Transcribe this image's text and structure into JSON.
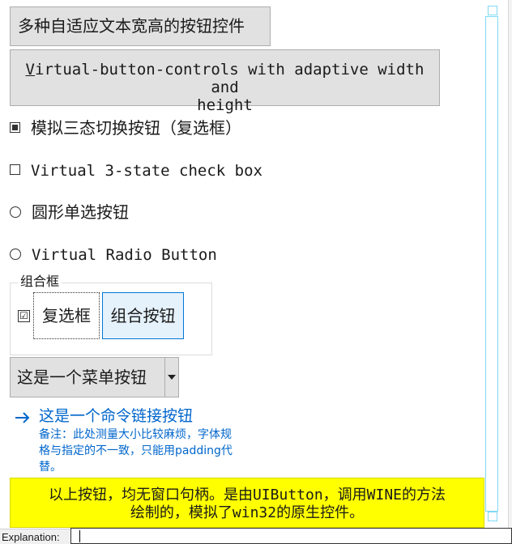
{
  "buttons": {
    "adaptive_cn": "多种自适应文本宽高的按钮控件",
    "adaptive_en_line1_first": "V",
    "adaptive_en_line1_rest": "irtual-button-controls with adaptive width and",
    "adaptive_en_line2": "height"
  },
  "checks": {
    "tristate_cn": "模拟三态切换按钮（复选框）",
    "tristate_en": "Virtual 3-state check box",
    "radio_cn": "圆形单选按钮",
    "radio_en": "Virtual Radio Button"
  },
  "groupbox": {
    "legend": "组合框",
    "check_mark": "☑",
    "checkbox_label": "复选框",
    "toggle_label": "组合按钮"
  },
  "menu_button": {
    "label": "这是一个菜单按钮",
    "arrow_icon": "dropdown-arrow-icon"
  },
  "command_link": {
    "title": "这是一个命令链接按钮",
    "note": "备注：此处测量大小比较麻烦，字体规格与指定的不一致，只能用padding代替。",
    "icon": "arrow-right-icon",
    "color": "#0066cc"
  },
  "yellow_note": {
    "line1": "以上按钮，均无窗口句柄。是由UIButton，调用WINE的方法",
    "line2": "绘制的，模拟了win32的原生控件。",
    "background": "#ffff00"
  },
  "explanation": {
    "label": "Explanation:",
    "value": ""
  }
}
